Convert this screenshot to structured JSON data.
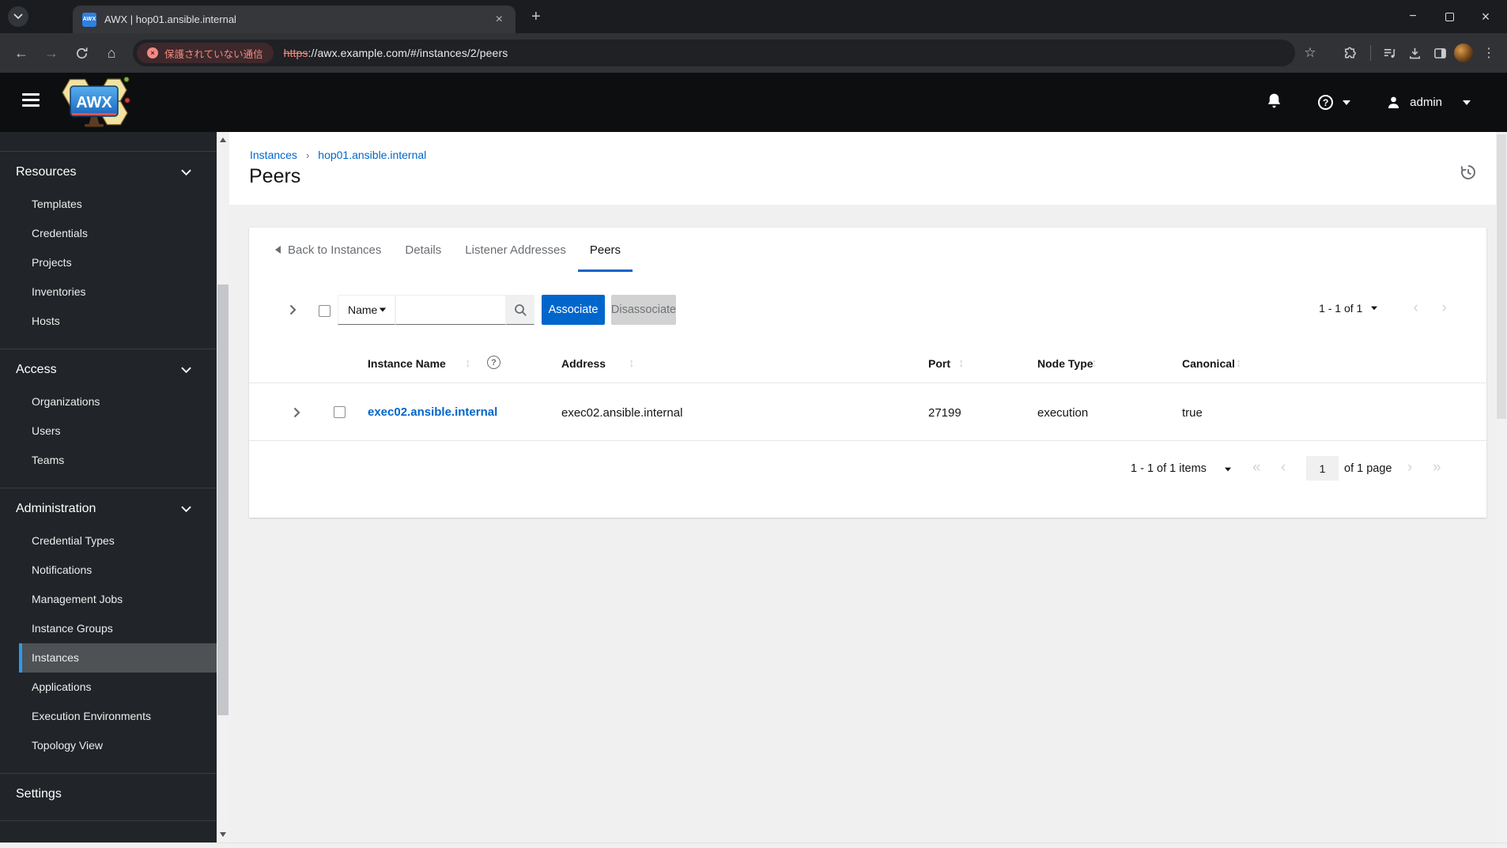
{
  "browser": {
    "tab": {
      "title": "AWX | hop01.ansible.internal",
      "favicon_text": "AWX"
    },
    "address": {
      "security_label": "保護されていない通信",
      "url_scheme": "https",
      "url_rest": "://awx.example.com/#/instances/2/peers"
    }
  },
  "masthead": {
    "logo_text": "AWX",
    "username": "admin"
  },
  "sidebar": {
    "groups": [
      {
        "label": "Resources",
        "items": [
          "Templates",
          "Credentials",
          "Projects",
          "Inventories",
          "Hosts"
        ]
      },
      {
        "label": "Access",
        "items": [
          "Organizations",
          "Users",
          "Teams"
        ]
      },
      {
        "label": "Administration",
        "active_item": "Instances",
        "items": [
          "Credential Types",
          "Notifications",
          "Management Jobs",
          "Instance Groups",
          "Instances",
          "Applications",
          "Execution Environments",
          "Topology View"
        ]
      },
      {
        "label": "Settings",
        "items": []
      }
    ]
  },
  "page": {
    "breadcrumb": [
      "Instances",
      "hop01.ansible.internal"
    ],
    "title": "Peers",
    "tabs": {
      "back": "Back to Instances",
      "items": [
        "Details",
        "Listener Addresses",
        "Peers"
      ],
      "active": "Peers"
    }
  },
  "toolbar": {
    "filter_selected": "Name",
    "search_placeholder": "",
    "associate_label": "Associate",
    "disassociate_label": "Disassociate",
    "pagination_summary": "1 - 1 of 1"
  },
  "table": {
    "columns": [
      "Instance Name",
      "Address",
      "Port",
      "Node Type",
      "Canonical"
    ],
    "rows": [
      {
        "instance_name": "exec02.ansible.internal",
        "address": "exec02.ansible.internal",
        "port": "27199",
        "node_type": "execution",
        "canonical": "true"
      }
    ]
  },
  "pagination": {
    "summary": "1 - 1 of 1 items",
    "current_page": "1",
    "page_label": "of 1 page"
  },
  "colors": {
    "primary_blue": "#0066cc",
    "nav_active_border": "#2b9af3",
    "link_blue": "#0066cc",
    "insecure_red": "#f28b82"
  }
}
